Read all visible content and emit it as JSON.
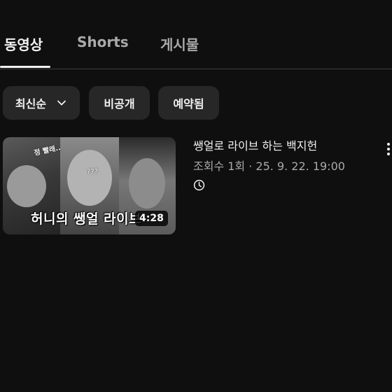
{
  "tabs": [
    {
      "label": "동영상",
      "active": true
    },
    {
      "label": "Shorts",
      "active": false
    },
    {
      "label": "게시물",
      "active": false
    }
  ],
  "filters": {
    "sort_label": "최신순",
    "private_label": "비공개",
    "scheduled_label": "예약됨"
  },
  "video": {
    "title": "쌩얼로 라이브 하는 백지헌",
    "meta": "조회수 1회 · 25. 9. 22. 19:00",
    "duration": "4:28",
    "thumbnail_caption": "허니의 쌩얼 라이브",
    "thumbnail_sticker_1": "정 빨래..",
    "thumbnail_sticker_2": "???"
  },
  "icons": {
    "sort_dropdown": "chevron-down-icon",
    "scheduled_status": "clock-icon",
    "more_actions": "more-vert-icon"
  },
  "colors": {
    "background": "#0f0f0f",
    "chip": "#272727",
    "text_primary": "#f1f1f1",
    "text_secondary": "#aaaaaa"
  }
}
